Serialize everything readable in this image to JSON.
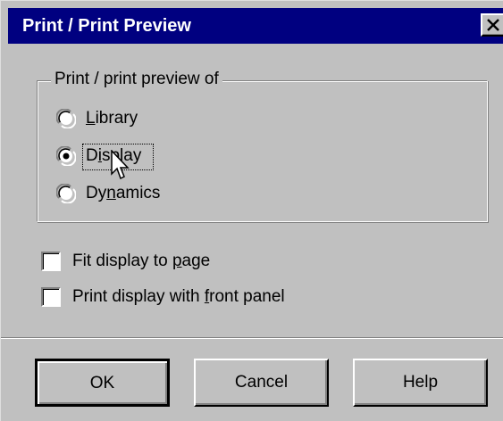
{
  "window": {
    "title": "Print / Print Preview",
    "close_glyph": "✕"
  },
  "group": {
    "label": "Print / print preview  of",
    "options": [
      {
        "label_pre": "",
        "mnemonic": "L",
        "label_post": "ibrary",
        "selected": false
      },
      {
        "label_pre": "D",
        "mnemonic": "i",
        "label_post": "splay",
        "selected": true
      },
      {
        "label_pre": "Dy",
        "mnemonic": "n",
        "label_post": "amics",
        "selected": false
      }
    ]
  },
  "checkboxes": [
    {
      "label_pre": "Fit display to ",
      "mnemonic": "p",
      "label_post": "age",
      "checked": false
    },
    {
      "label_pre": "Print display with ",
      "mnemonic": "f",
      "label_post": "ront panel",
      "checked": false
    }
  ],
  "buttons": {
    "ok": "OK",
    "cancel": "Cancel",
    "help": "Help"
  },
  "colors": {
    "titlebar": "#000080",
    "face": "#c0c0c0"
  },
  "icons": {
    "close": "close-icon",
    "cursor": "mouse-pointer-icon"
  }
}
